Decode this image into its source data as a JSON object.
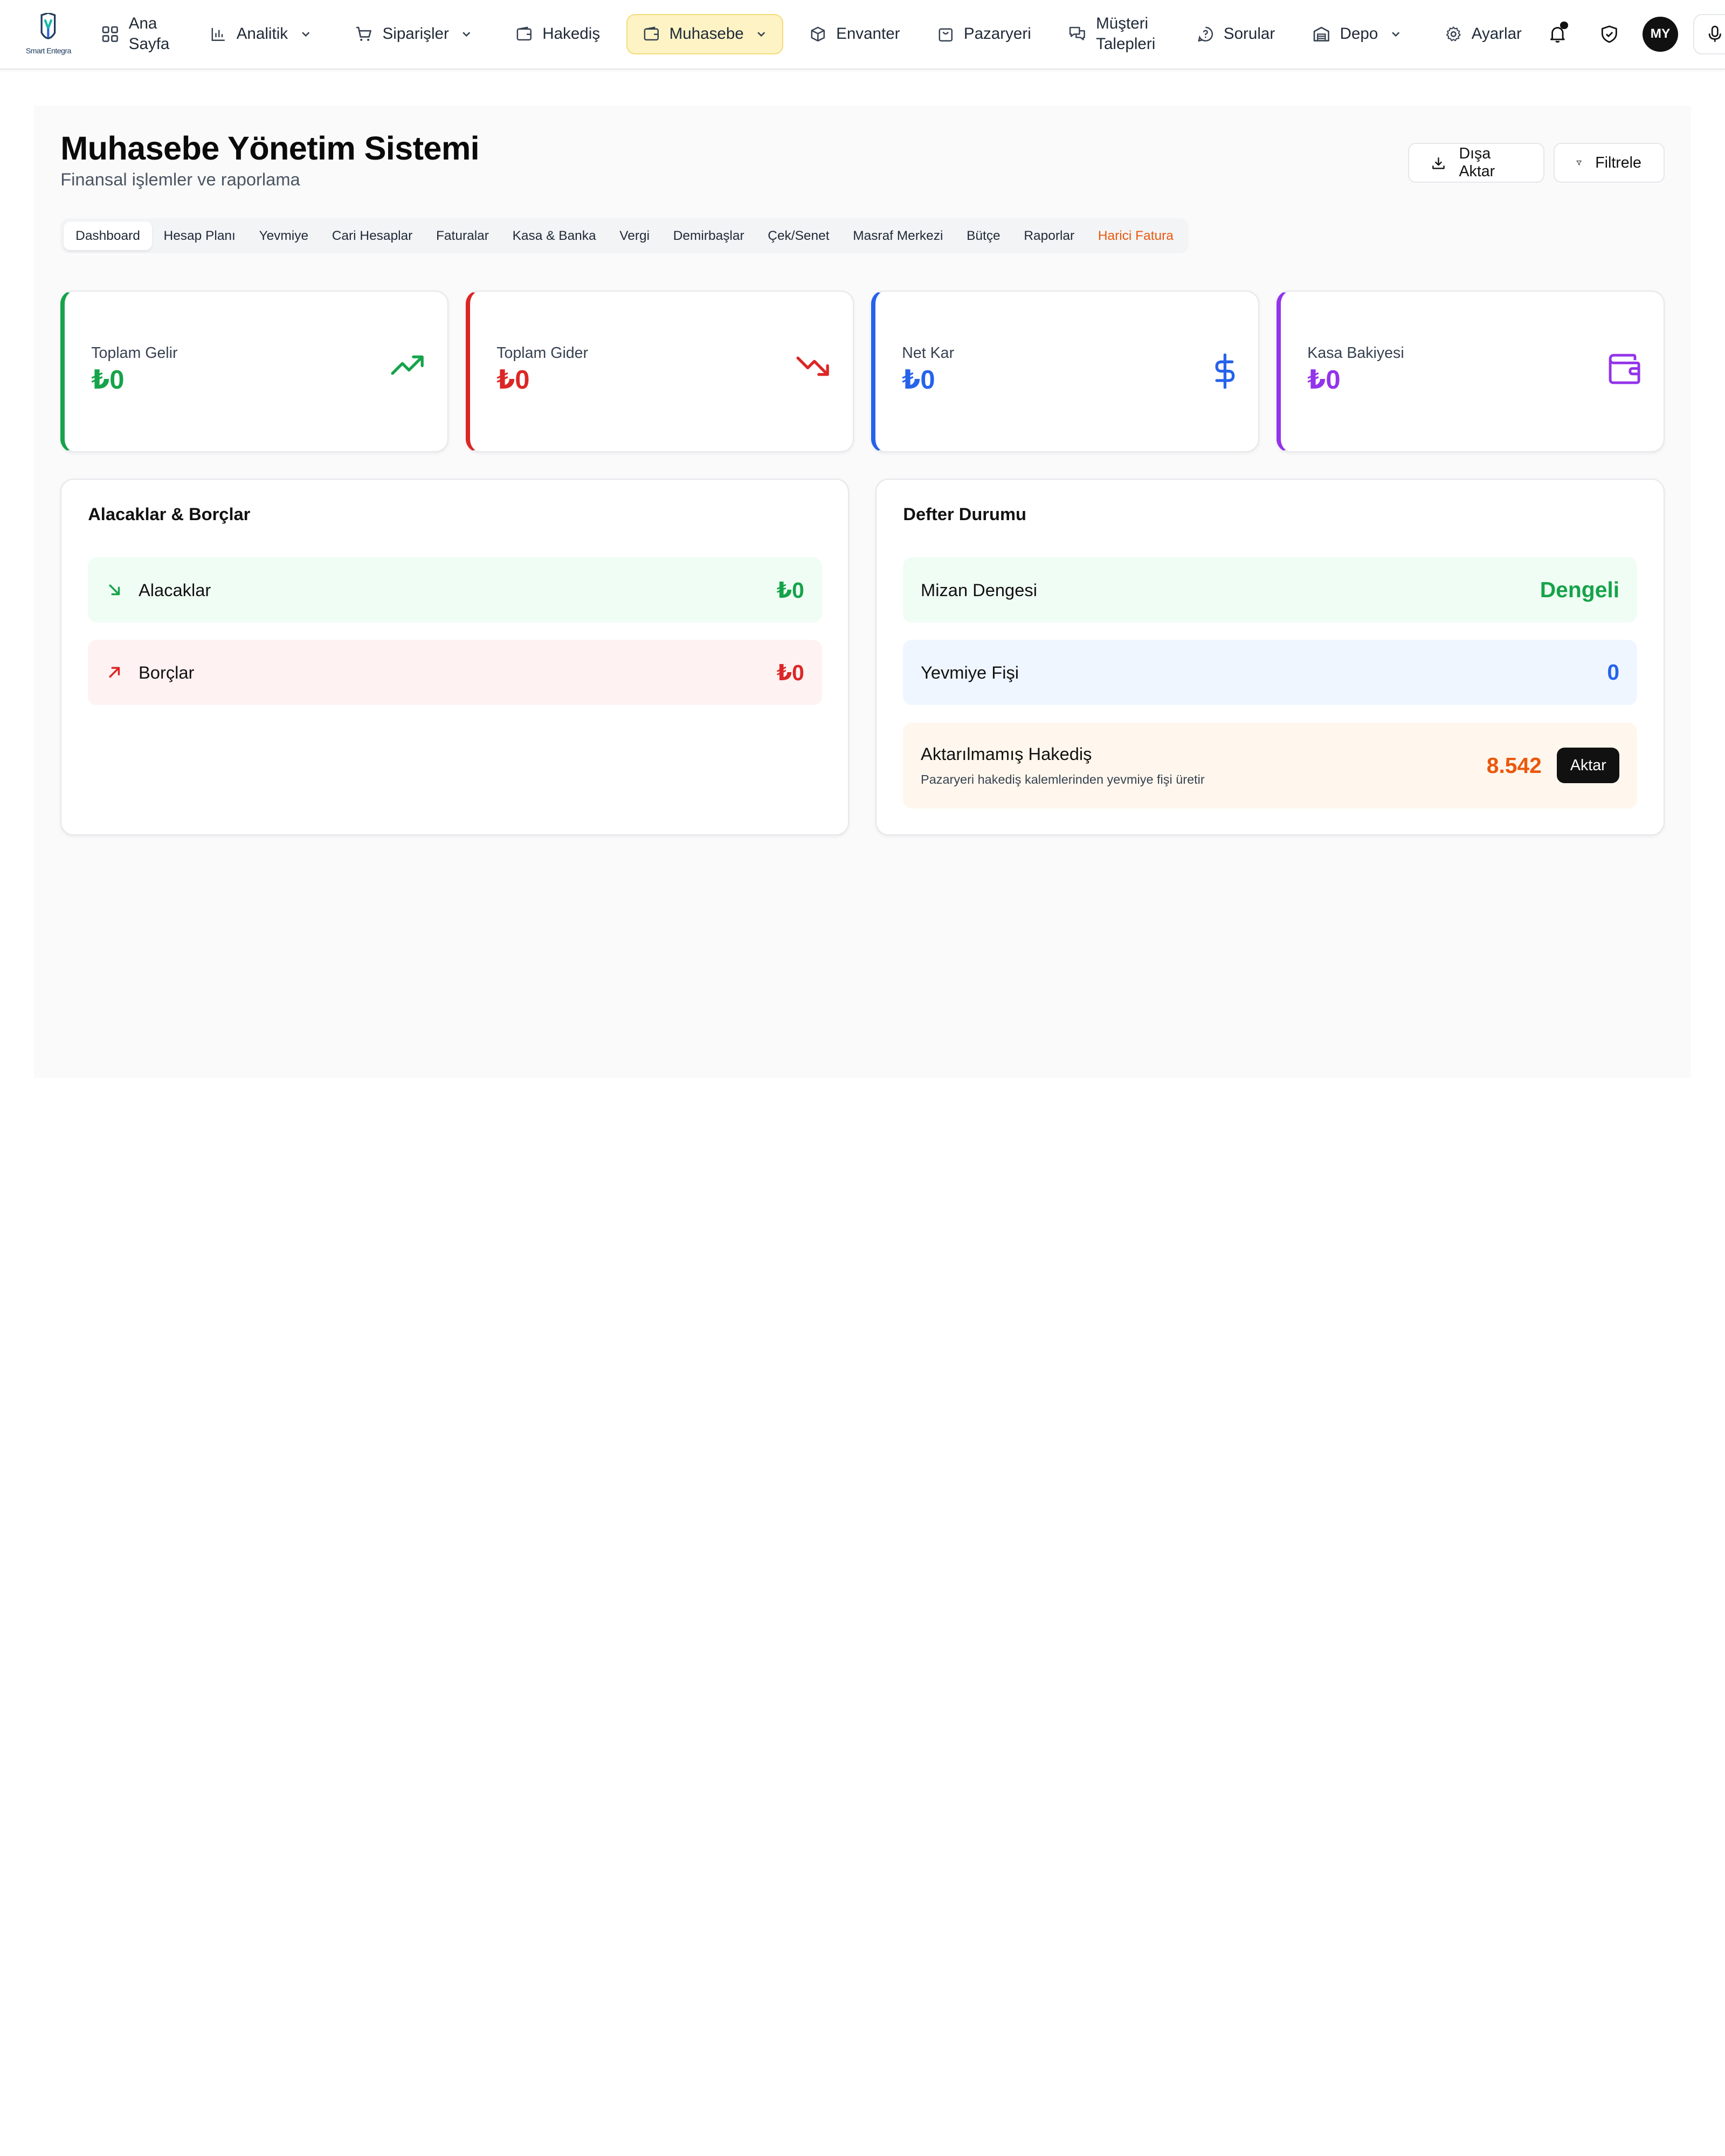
{
  "brand": {
    "logo_text": "Smart Entegra"
  },
  "nav": {
    "home": "Ana Sayfa",
    "analytics": "Analitik",
    "orders": "Siparişler",
    "hakedis": "Hakediş",
    "accounting": "Muhasebe",
    "inventory": "Envanter",
    "marketplace": "Pazaryeri",
    "customer_requests": "Müşteri Talepleri",
    "questions": "Sorular",
    "warehouse": "Depo",
    "settings": "Ayarlar",
    "avatar_initials": "MY"
  },
  "header": {
    "title": "Muhasebe Yönetim Sistemi",
    "subtitle": "Finansal işlemler ve raporlama",
    "export_label": "Dışa Aktar",
    "filter_label": "Filtrele"
  },
  "tabs": [
    {
      "label": "Dashboard"
    },
    {
      "label": "Hesap Planı"
    },
    {
      "label": "Yevmiye"
    },
    {
      "label": "Cari Hesaplar"
    },
    {
      "label": "Faturalar"
    },
    {
      "label": "Kasa & Banka"
    },
    {
      "label": "Vergi"
    },
    {
      "label": "Demirbaşlar"
    },
    {
      "label": "Çek/Senet"
    },
    {
      "label": "Masraf Merkezi"
    },
    {
      "label": "Bütçe"
    },
    {
      "label": "Raporlar"
    },
    {
      "label": "Harici Fatura"
    }
  ],
  "stats": {
    "income": {
      "label": "Toplam Gelir",
      "value": "₺0",
      "color": "#16a34a",
      "icon": "trending-up-icon"
    },
    "expense": {
      "label": "Toplam Gider",
      "value": "₺0",
      "color": "#dc2626",
      "icon": "trending-down-icon"
    },
    "profit": {
      "label": "Net Kar",
      "value": "₺0",
      "color": "#2563eb",
      "icon": "dollar-icon"
    },
    "cash": {
      "label": "Kasa Bakiyesi",
      "value": "₺0",
      "color": "#9333ea",
      "icon": "wallet-icon"
    }
  },
  "receivables": {
    "title": "Alacaklar & Borçlar",
    "receivable_label": "Alacaklar",
    "receivable_value": "₺0",
    "payable_label": "Borçlar",
    "payable_value": "₺0"
  },
  "ledger": {
    "title": "Defter Durumu",
    "balance_label": "Mizan Dengesi",
    "balance_value": "Dengeli",
    "journal_label": "Yevmiye Fişi",
    "journal_value": "0",
    "pending_label": "Aktarılmamış Hakediş",
    "pending_sub": "Pazaryeri hakediş kalemlerinden yevmiye fişi üretir",
    "pending_value": "8.542",
    "transfer_label": "Aktar"
  }
}
